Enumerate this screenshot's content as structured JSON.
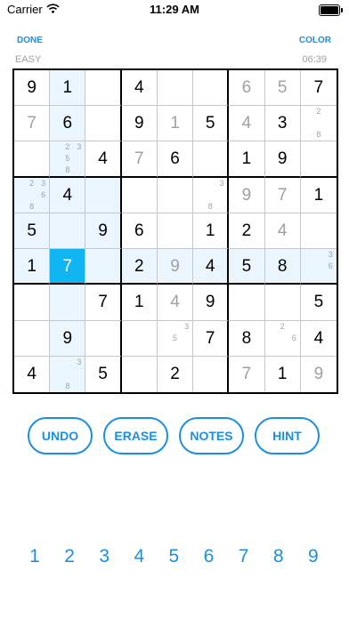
{
  "status_bar": {
    "carrier": "Carrier",
    "time": "11:29 AM"
  },
  "header": {
    "done_label": "DONE",
    "color_label": "COLOR",
    "difficulty": "EASY",
    "timer": "06:39"
  },
  "board": [
    [
      {
        "v": "9",
        "t": "given"
      },
      {
        "v": "1",
        "t": "given"
      },
      {},
      {
        "v": "4",
        "t": "given"
      },
      {},
      {},
      {
        "v": "6",
        "t": "user"
      },
      {
        "v": "5",
        "t": "user"
      },
      {
        "v": "7",
        "t": "given"
      }
    ],
    [
      {
        "v": "7",
        "t": "user"
      },
      {
        "v": "6",
        "t": "given"
      },
      {},
      {
        "v": "9",
        "t": "given"
      },
      {
        "v": "1",
        "t": "user"
      },
      {
        "v": "5",
        "t": "given"
      },
      {
        "v": "4",
        "t": "user"
      },
      {
        "v": "3",
        "t": "given"
      },
      {
        "n": [
          "2",
          "8"
        ]
      }
    ],
    [
      {},
      {
        "n": [
          "2",
          "3",
          "5",
          "8"
        ]
      },
      {
        "v": "4",
        "t": "given"
      },
      {
        "v": "7",
        "t": "user"
      },
      {
        "v": "6",
        "t": "given"
      },
      {},
      {
        "v": "1",
        "t": "given"
      },
      {
        "v": "9",
        "t": "given"
      },
      {}
    ],
    [
      {
        "n": [
          "2",
          "3",
          "6",
          "8"
        ]
      },
      {
        "v": "4",
        "t": "given"
      },
      {},
      {},
      {},
      {
        "n": [
          "3",
          "8"
        ]
      },
      {
        "v": "9",
        "t": "user"
      },
      {
        "v": "7",
        "t": "user"
      },
      {
        "v": "1",
        "t": "given"
      }
    ],
    [
      {
        "v": "5",
        "t": "given"
      },
      {},
      {
        "v": "9",
        "t": "given"
      },
      {
        "v": "6",
        "t": "given"
      },
      {},
      {
        "v": "1",
        "t": "given"
      },
      {
        "v": "2",
        "t": "given"
      },
      {
        "v": "4",
        "t": "user"
      },
      {}
    ],
    [
      {
        "v": "1",
        "t": "given"
      },
      {
        "v": "7",
        "t": "user"
      },
      {},
      {
        "v": "2",
        "t": "given"
      },
      {
        "v": "9",
        "t": "user"
      },
      {
        "v": "4",
        "t": "given"
      },
      {
        "v": "5",
        "t": "given"
      },
      {
        "v": "8",
        "t": "given"
      },
      {
        "n": [
          "3",
          "6"
        ]
      }
    ],
    [
      {},
      {},
      {
        "v": "7",
        "t": "given"
      },
      {
        "v": "1",
        "t": "given"
      },
      {
        "v": "4",
        "t": "user"
      },
      {
        "v": "9",
        "t": "given"
      },
      {},
      {},
      {
        "v": "5",
        "t": "given"
      }
    ],
    [
      {},
      {
        "v": "9",
        "t": "given"
      },
      {},
      {},
      {
        "n": [
          "3",
          "5"
        ]
      },
      {
        "v": "7",
        "t": "given"
      },
      {
        "v": "8",
        "t": "given"
      },
      {
        "n": [
          "2",
          "6"
        ]
      },
      {
        "v": "4",
        "t": "given"
      }
    ],
    [
      {
        "v": "4",
        "t": "given"
      },
      {
        "n": [
          "3",
          "8"
        ]
      },
      {
        "v": "5",
        "t": "given"
      },
      {},
      {
        "v": "2",
        "t": "given"
      },
      {},
      {
        "v": "7",
        "t": "user"
      },
      {
        "v": "1",
        "t": "given"
      },
      {
        "v": "9",
        "t": "user"
      }
    ]
  ],
  "selected": {
    "row": 5,
    "col": 1
  },
  "actions": {
    "undo": "UNDO",
    "erase": "ERASE",
    "notes": "NOTES",
    "hint": "HINT"
  },
  "numpad": [
    "1",
    "2",
    "3",
    "4",
    "5",
    "6",
    "7",
    "8",
    "9"
  ],
  "colors": {
    "accent": "#1a8fe3",
    "selected": "#10b6f1",
    "highlight": "#eaf5fd",
    "user_digit": "#a0a0a0"
  }
}
